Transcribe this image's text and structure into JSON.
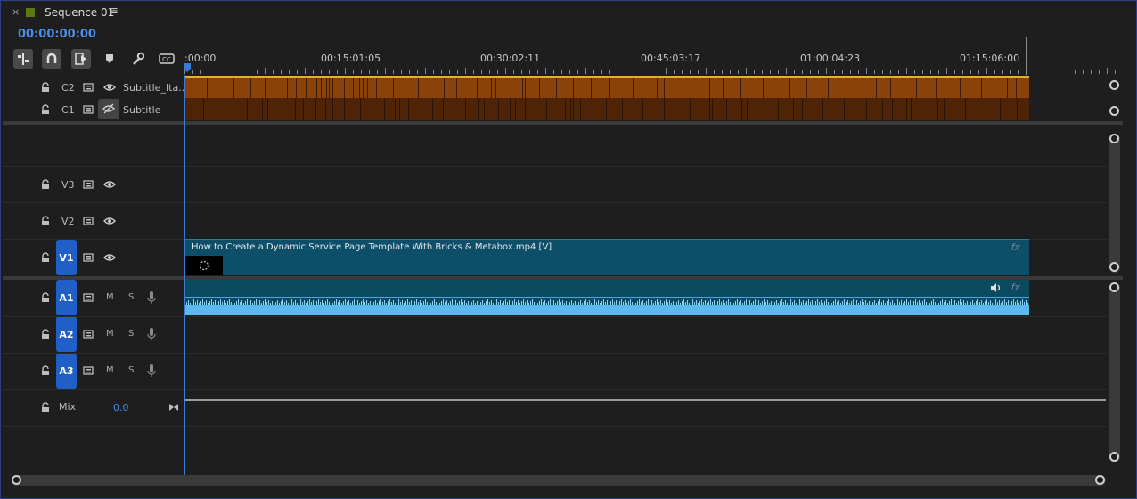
{
  "tab": {
    "close": "×",
    "title": "Sequence 01",
    "menu": "≡"
  },
  "timecode": "00:00:00:00",
  "tools": [
    "snap-in-sequence-icon",
    "magnet-icon",
    "linked-selection-icon",
    "add-marker-icon",
    "wrench-icon",
    "captions-icon"
  ],
  "ruler": {
    "labels": [
      ":00:00",
      "00:15:01:05",
      "00:30:02:11",
      "00:45:03:17",
      "01:00:04:23",
      "01:15:06:00"
    ]
  },
  "subtitle_tracks": [
    {
      "id": "C2",
      "name": "Subtitle_Ita..."
    },
    {
      "id": "C1",
      "name": "Subtitle"
    }
  ],
  "video_tracks": [
    {
      "id": "V3"
    },
    {
      "id": "V2"
    },
    {
      "id": "V1",
      "active": true
    }
  ],
  "audio_tracks": [
    {
      "id": "A1",
      "m": "M",
      "s": "S"
    },
    {
      "id": "A2",
      "m": "M",
      "s": "S"
    },
    {
      "id": "A3",
      "m": "M",
      "s": "S"
    }
  ],
  "mix": {
    "label": "Mix",
    "value": "0.0"
  },
  "video_clip": {
    "title": "How to Create a Dynamic Service Page Template With Bricks & Metabox.mp4 [V]",
    "fx": "fx"
  },
  "audio_clip": {
    "fx": "fx"
  },
  "colors": {
    "accent": "#1f5fc7",
    "timecode": "#4d8fe8",
    "subtitle_clip": "#8a4208",
    "video_clip": "#0d4e68",
    "audio_wave": "#5bb8f0"
  }
}
